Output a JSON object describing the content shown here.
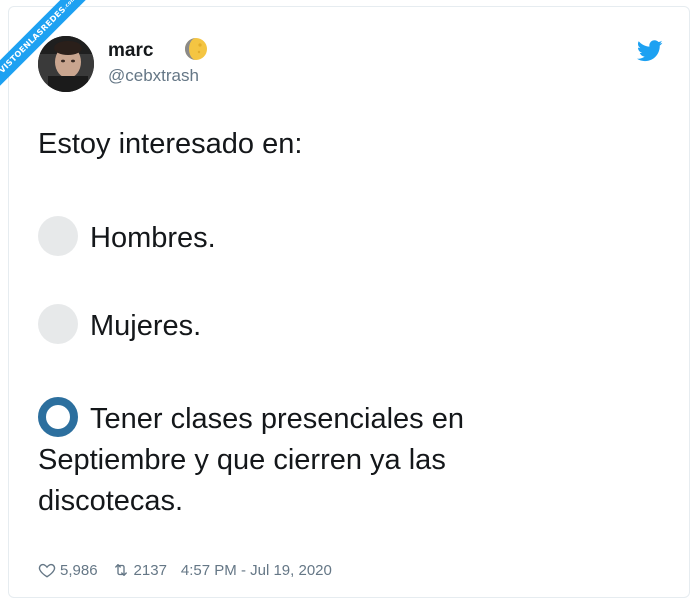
{
  "watermark": {
    "text": "VISTOENLASREDES",
    "sub": ".com"
  },
  "user": {
    "name": "marc",
    "handle": "@cebxtrash"
  },
  "tweet": {
    "intro": "Estoy interesado en:",
    "options": [
      {
        "label": "Hombres.",
        "selected": false
      },
      {
        "label": "Mujeres.",
        "selected": false
      },
      {
        "label": "Tener clases presenciales en Septiembre y que cierren ya las discotecas.",
        "selected": true
      }
    ]
  },
  "stats": {
    "likes": "5,986",
    "retweets": "2137",
    "timestamp": "4:57 PM - Jul 19, 2020"
  },
  "icons": {
    "moon": "waning-moon-icon",
    "bird": "twitter-bird-icon",
    "heart": "heart-icon",
    "retweet": "retweet-icon"
  },
  "colors": {
    "twitter_blue": "#1da1f2",
    "radio_selected": "#2c6f9e",
    "radio_unselected": "#e7e9ea",
    "muted_text": "#657786"
  }
}
